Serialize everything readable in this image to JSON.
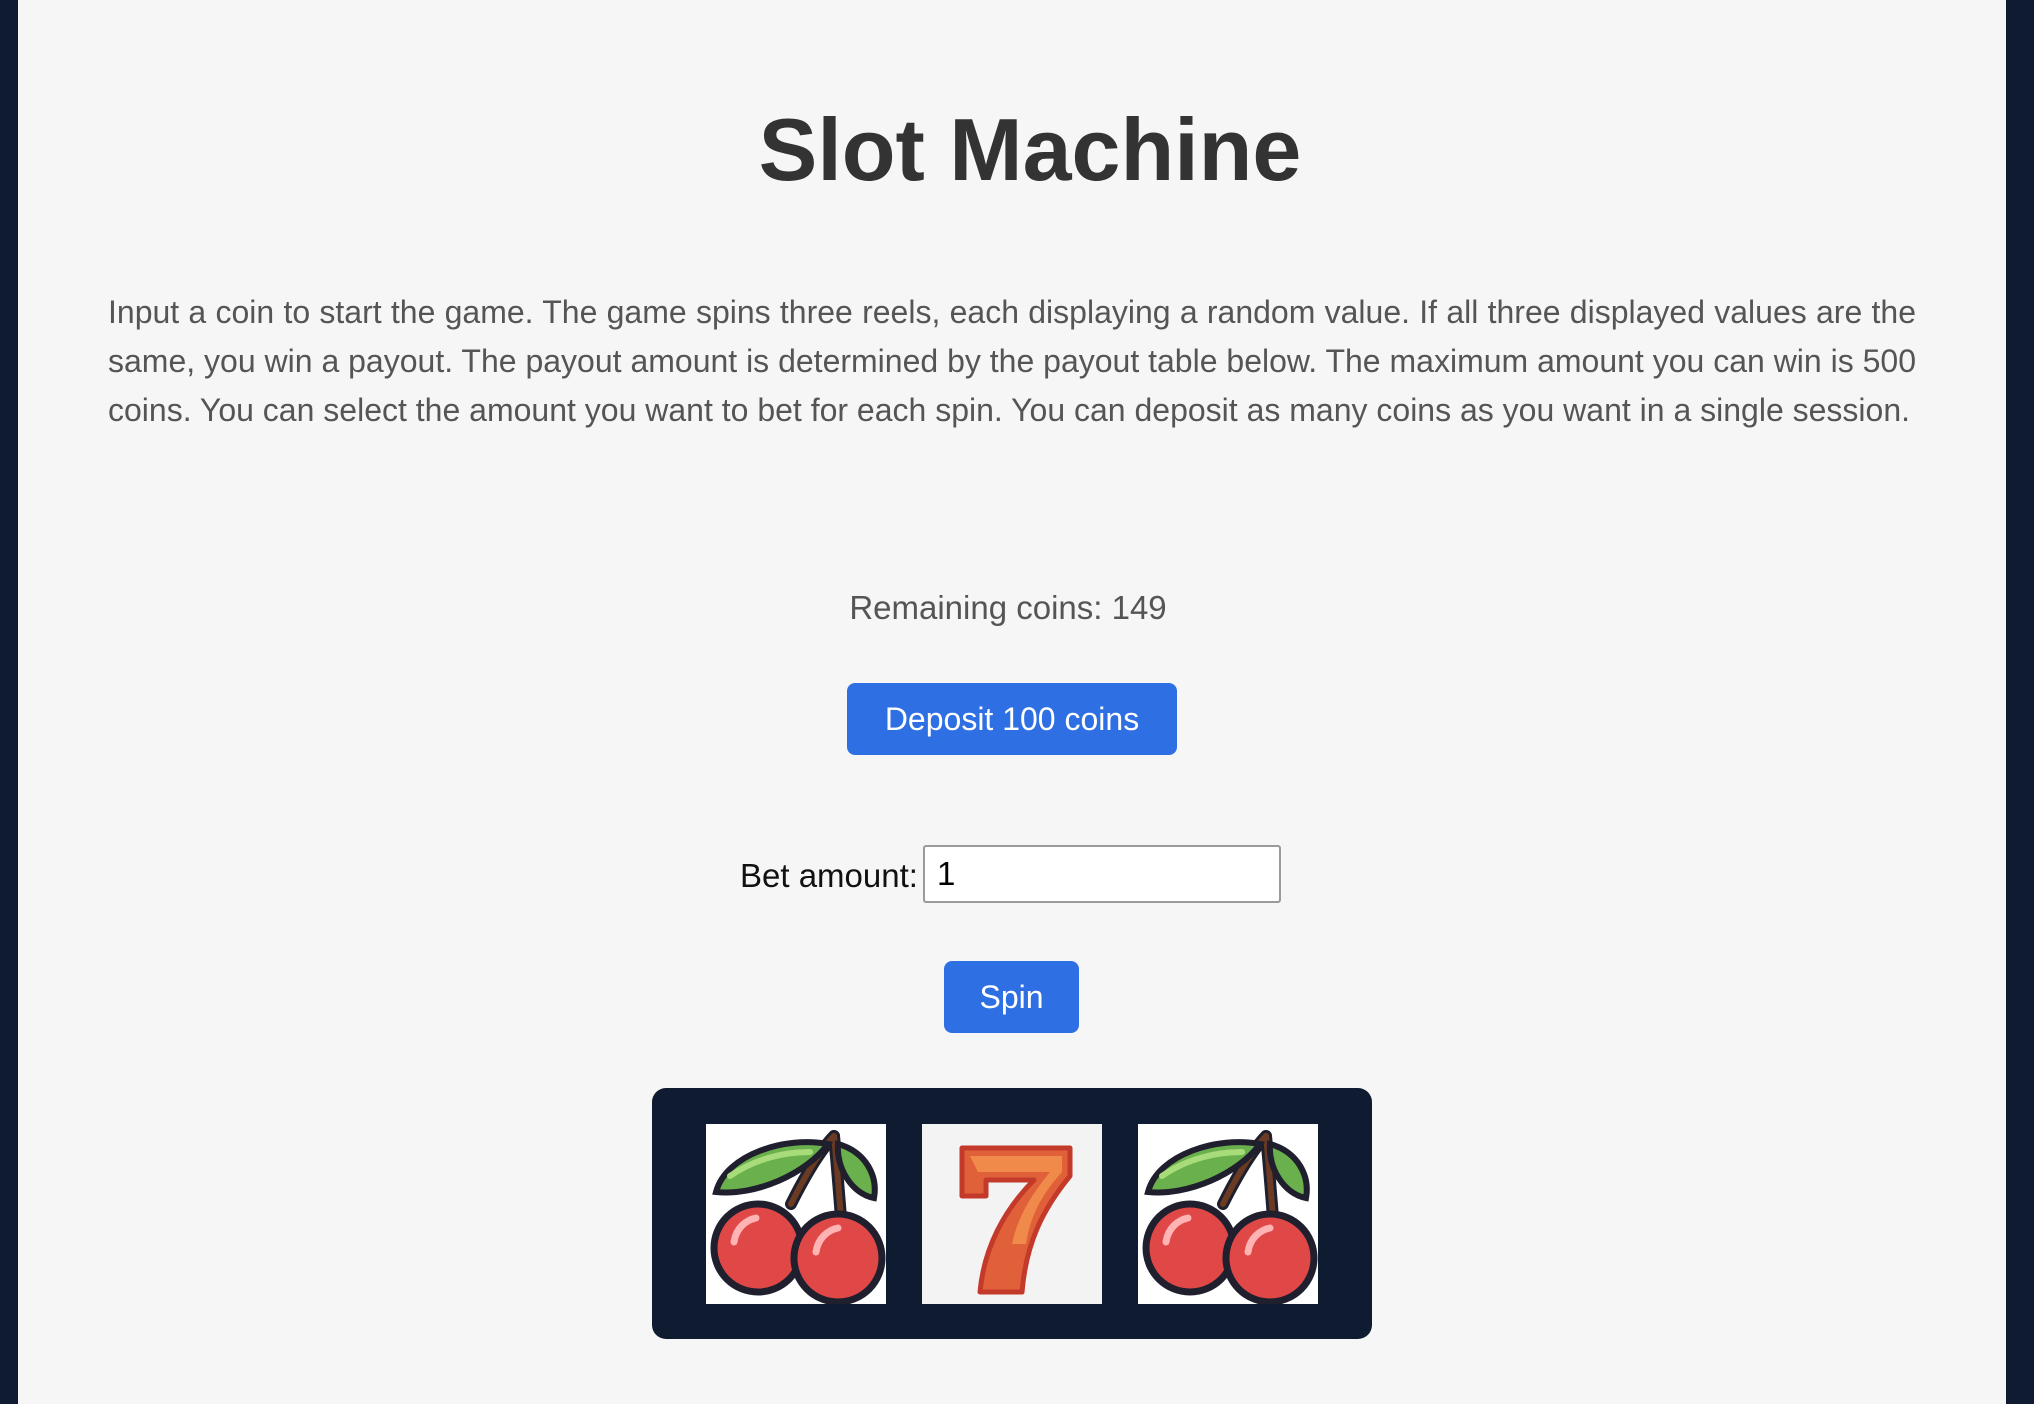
{
  "page": {
    "title": "Slot Machine",
    "description": "Input a coin to start the game. The game spins three reels, each displaying a random value. If all three displayed values are the same, you win a payout. The payout amount is determined by the payout table below. The maximum amount you can win is 500 coins. You can select the amount you want to bet for each spin. You can deposit as many coins as you want in a single session."
  },
  "status": {
    "remaining_coins": "Remaining coins: 149"
  },
  "controls": {
    "deposit_label": "Deposit 100 coins",
    "bet_label": "Bet amount:",
    "bet_value": "1",
    "spin_label": "Spin"
  },
  "reels": [
    {
      "symbol": "cherry-icon"
    },
    {
      "symbol": "seven-icon"
    },
    {
      "symbol": "cherry-icon"
    }
  ],
  "colors": {
    "accent": "#2f6fe4",
    "frame": "#0f1b30",
    "background": "#f6f6f6"
  }
}
